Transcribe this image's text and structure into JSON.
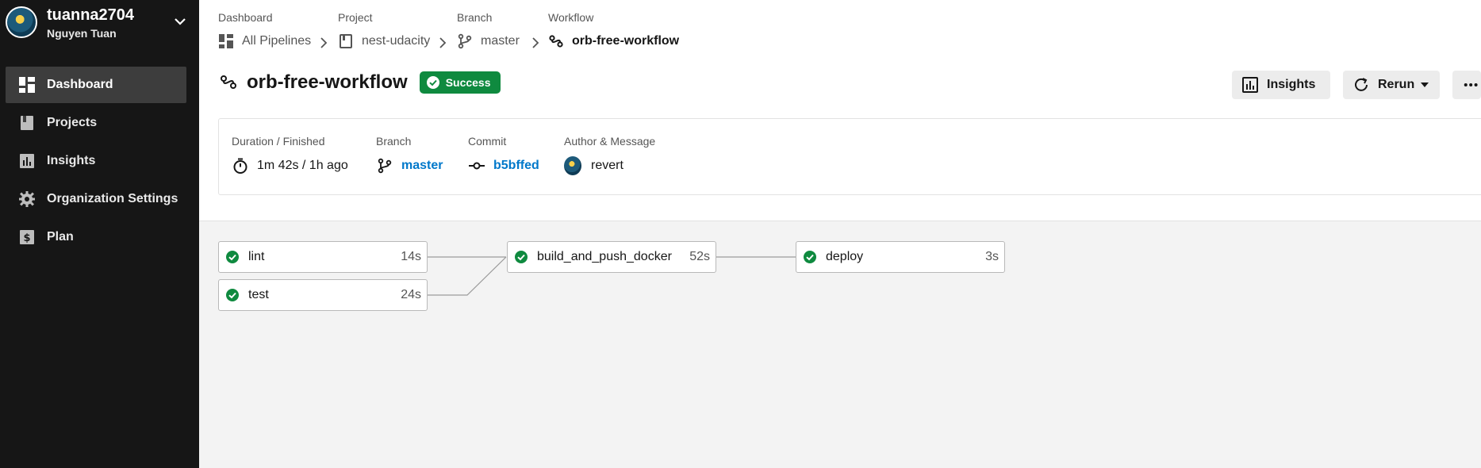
{
  "org": {
    "name": "tuanna2704",
    "user": "Nguyen Tuan"
  },
  "nav": [
    {
      "label": "Dashboard",
      "icon": "dashboard-icon",
      "active": true
    },
    {
      "label": "Projects",
      "icon": "projects-icon"
    },
    {
      "label": "Insights",
      "icon": "insights-icon"
    },
    {
      "label": "Organization Settings",
      "icon": "gear-icon"
    },
    {
      "label": "Plan",
      "icon": "dollar-icon"
    }
  ],
  "breadcrumb": {
    "labels": [
      "Dashboard",
      "Project",
      "Branch",
      "Workflow"
    ],
    "items": [
      "All Pipelines",
      "nest-udacity",
      "master",
      "orb-free-workflow"
    ]
  },
  "workflow": {
    "title": "orb-free-workflow",
    "status": "Success"
  },
  "actions": {
    "insights": "Insights",
    "rerun": "Rerun"
  },
  "details": {
    "duration_label": "Duration / Finished",
    "duration_value": "1m 42s / 1h ago",
    "branch_label": "Branch",
    "branch_value": "master",
    "commit_label": "Commit",
    "commit_value": "b5bffed",
    "author_label": "Author & Message",
    "author_message": "revert"
  },
  "jobs": [
    {
      "name": "lint",
      "duration": "14s",
      "status": "success"
    },
    {
      "name": "test",
      "duration": "24s",
      "status": "success"
    },
    {
      "name": "build_and_push_docker",
      "duration": "52s",
      "status": "success"
    },
    {
      "name": "deploy",
      "duration": "3s",
      "status": "success"
    }
  ],
  "colors": {
    "sidebar": "#161616",
    "success": "#0f8a3f",
    "link": "#0078ca"
  }
}
